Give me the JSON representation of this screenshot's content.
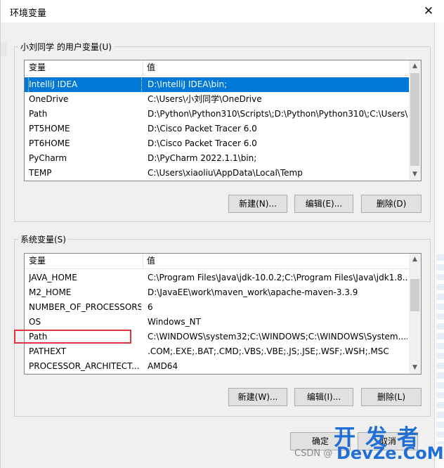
{
  "window": {
    "title": "环境变量",
    "close_label": "✕"
  },
  "user_vars": {
    "group_label": "小刘同学 的用户变量(U)",
    "columns": [
      "变量",
      "值"
    ],
    "rows": [
      {
        "name": "IntelliJ IDEA",
        "value": "D:\\IntelliJ IDEA\\bin;",
        "selected": true
      },
      {
        "name": "OneDrive",
        "value": "C:\\Users\\小刘同学\\OneDrive"
      },
      {
        "name": "Path",
        "value": "D:\\Python\\Python310\\Scripts\\;D:\\Python\\Python310\\;C:\\Users\\..."
      },
      {
        "name": "PT5HOME",
        "value": "D:\\Cisco Packet Tracer 6.0"
      },
      {
        "name": "PT6HOME",
        "value": "D:\\Cisco Packet Tracer 6.0"
      },
      {
        "name": "PyCharm",
        "value": "D:\\PyCharm 2022.1.1\\bin;"
      },
      {
        "name": "TEMP",
        "value": "C:\\Users\\xiaoliu\\AppData\\Local\\Temp"
      }
    ],
    "buttons": {
      "new": "新建(N)...",
      "edit": "编辑(E)...",
      "delete": "删除(D)"
    }
  },
  "system_vars": {
    "group_label": "系统变量(S)",
    "columns": [
      "变量",
      "值"
    ],
    "rows": [
      {
        "name": "JAVA_HOME",
        "value": "C:\\Program Files\\Java\\jdk-10.0.2;C:\\Program Files\\Java\\jdk1.8...."
      },
      {
        "name": "M2_HOME",
        "value": "D:\\JavaEE\\work\\maven_work\\apache-maven-3.3.9"
      },
      {
        "name": "NUMBER_OF_PROCESSORS",
        "value": "6"
      },
      {
        "name": "OS",
        "value": "Windows_NT"
      },
      {
        "name": "Path",
        "value": "C:\\WINDOWS\\system32;C:\\WINDOWS;C:\\WINDOWS\\System...."
      },
      {
        "name": "PATHEXT",
        "value": ".COM;.EXE;.BAT;.CMD;.VBS;.VBE;.JS;.JSE;.WSF;.WSH;.MSC"
      },
      {
        "name": "PROCESSOR_ARCHITECT...",
        "value": "AMD64"
      }
    ],
    "buttons": {
      "new": "新建(W)...",
      "edit": "编辑(I)...",
      "delete": "删除(L)"
    }
  },
  "footer": {
    "ok": "确定",
    "cancel": "取消"
  },
  "watermark": {
    "line1": "开发者",
    "line2": "DevZe.CoM",
    "csdn": "CSDN @"
  },
  "colors": {
    "selection": "#0078d7",
    "highlight_box": "#e2343e",
    "watermark": "#1f6fd6"
  },
  "icons": [
    "close-icon",
    "scroll-up-icon",
    "scroll-down-icon"
  ]
}
